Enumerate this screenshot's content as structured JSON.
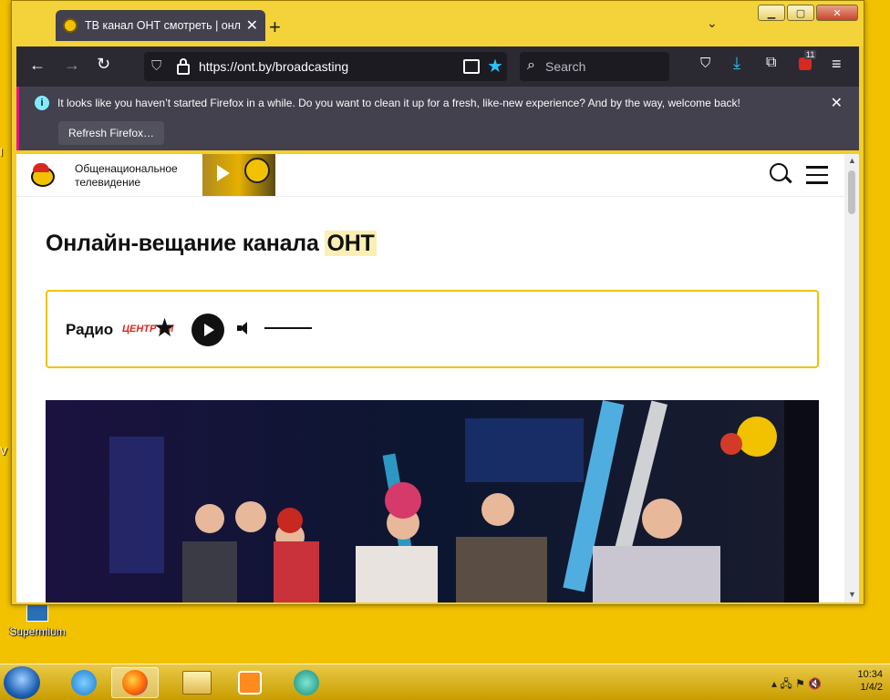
{
  "desktop": {
    "icon_label": "Supermium",
    "edge_glyphs": [
      "V",
      "l"
    ]
  },
  "browser": {
    "tab_title": "ТВ канал ОНТ смотреть | онлайн",
    "new_tab": "+",
    "list_all_tabs": "⌄",
    "url": "https://ont.by/broadcasting",
    "search_placeholder": "Search",
    "extensions_badge": "11",
    "notification": {
      "message": "It looks like you haven’t started Firefox in a while. Do you want to clean it up for a fresh, like-new experience? And by the way, welcome back!",
      "button": "Refresh Firefox…"
    },
    "accent_color": "#2ac3f6"
  },
  "page": {
    "site_title_line1": "Общенациональное",
    "site_title_line2": "телевидение",
    "heading_main": "Онлайн-вещание канала ",
    "heading_highlight": "ОНТ",
    "radio_label": "Радио",
    "radio_logo_text": "ЦЕНТР FM",
    "brand_color": "#f2c200"
  },
  "taskbar": {
    "clock_time": "10:34",
    "clock_date": "1/4/2"
  }
}
